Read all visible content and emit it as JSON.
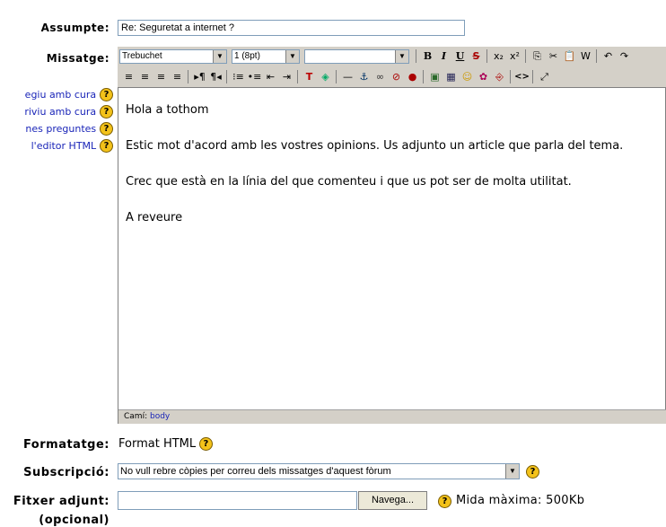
{
  "labels": {
    "subject": "Assumpte:",
    "message": "Missatge:",
    "format": "Formatatge:",
    "subscription": "Subscripció:",
    "attachment": "Fitxer adjunt:",
    "attachment_optional": "(opcional)"
  },
  "subject": {
    "value": "Re: Seguretat a internet ?"
  },
  "help_links": [
    "egiu amb cura",
    "riviu amb cura",
    "nes preguntes",
    "l'editor HTML"
  ],
  "help_glyph": "?",
  "toolbar": {
    "font_family": "Trebuchet",
    "font_size": "1 (8pt)",
    "paragraph_style": "",
    "dropdown_arrow": "▼",
    "row1_icons": [
      "bold-icon",
      "italic-icon",
      "underline-icon",
      "strikethrough-icon",
      "subscript-icon",
      "superscript-icon",
      "copy-icon",
      "cut-icon",
      "paste-icon",
      "clean-word-icon",
      "undo-icon",
      "redo-icon"
    ],
    "row1_glyphs": [
      "B",
      "I",
      "U",
      "S",
      "x₂",
      "x²",
      "⎘",
      "✂",
      "📋",
      "W",
      "↶",
      "↷"
    ],
    "row2_icons": [
      "align-left-icon",
      "align-center-icon",
      "align-right-icon",
      "justify-icon",
      "ltr-icon",
      "rtl-icon",
      "ordered-list-icon",
      "unordered-list-icon",
      "outdent-icon",
      "indent-icon",
      "text-color-icon",
      "background-color-icon",
      "horizontal-rule-icon",
      "anchor-icon",
      "link-icon",
      "unlink-icon",
      "nolink-icon",
      "image-icon",
      "table-icon",
      "smiley-icon",
      "special-char-icon",
      "search-replace-icon",
      "html-source-icon",
      "fullscreen-icon"
    ],
    "row2_glyphs": [
      "≡",
      "≡",
      "≡",
      "≡",
      "▸¶",
      "¶◂",
      "⁝≡",
      "•≡",
      "⇤",
      "⇥",
      "T",
      "◈",
      "—",
      "⚓",
      "∞",
      "⊘",
      "●",
      "▣",
      "▦",
      "☺",
      "✿",
      "⎆",
      "<>",
      "⤢"
    ]
  },
  "editor": {
    "paragraphs": [
      "Hola a tothom",
      "Estic mot d'acord amb les vostres opinions. Us adjunto un article que parla del tema.",
      "Crec que està en la línia del que comenteu i que us pot ser de molta utilitat.",
      "A reveure"
    ],
    "status_label": "Camí:",
    "status_path": "body"
  },
  "format": {
    "value": "Format HTML"
  },
  "subscription": {
    "selected": "No vull rebre còpies per correu dels missatges d'aquest fòrum"
  },
  "attachment": {
    "browse_label": "Navega...",
    "max_size": "Mida màxima: 500Kb"
  },
  "colors": {
    "toolbar_bg": "#d4d0c8",
    "link": "#1a25b8",
    "help_icon": "#f3c21a"
  }
}
